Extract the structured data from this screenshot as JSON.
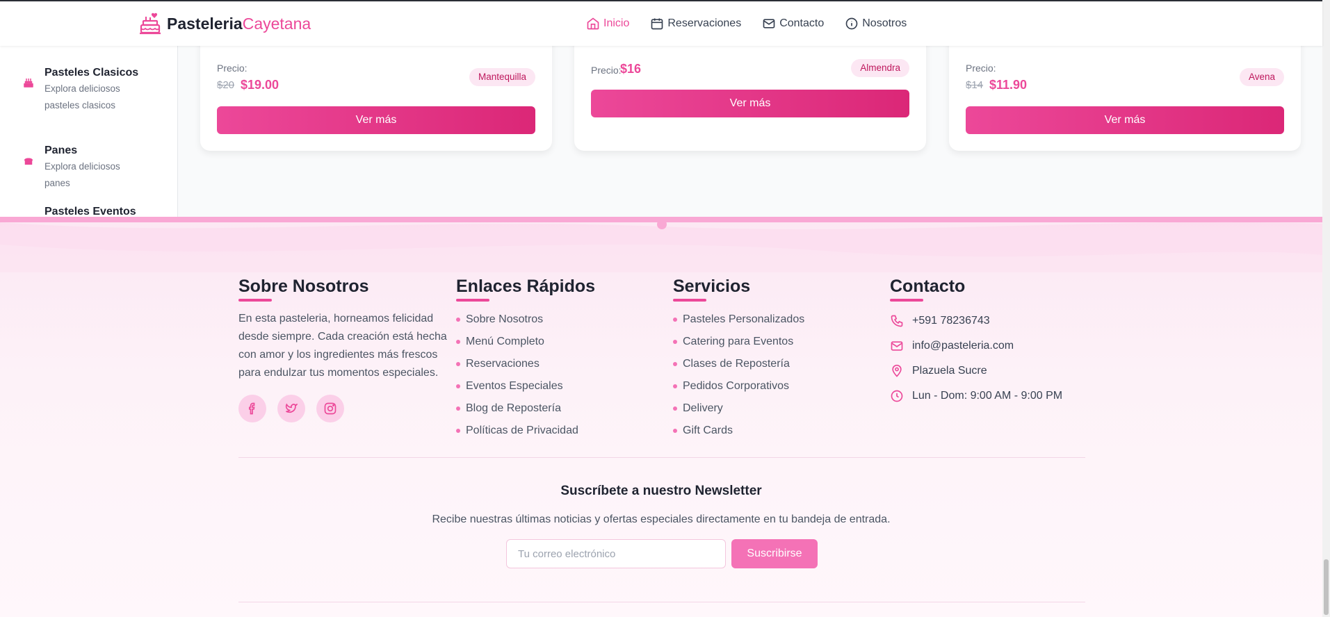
{
  "brand": {
    "name_bold": "Pasteleria",
    "name_light": "Cayetana",
    "logo_icon": "cake-icon"
  },
  "nav": [
    {
      "label": "Inicio",
      "icon": "home-icon",
      "active": true
    },
    {
      "label": "Reservaciones",
      "icon": "calendar-icon",
      "active": false
    },
    {
      "label": "Contacto",
      "icon": "mail-icon",
      "active": false
    },
    {
      "label": "Nosotros",
      "icon": "info-icon",
      "active": false
    }
  ],
  "sidebar": {
    "items": [
      {
        "title": "Pasteles Clasicos",
        "desc": "Explora deliciosos pasteles clasicos",
        "icon": "cake-icon"
      },
      {
        "title": "Panes",
        "desc": "Explora deliciosos panes",
        "icon": "bread-icon"
      },
      {
        "title": "Pasteles Eventos",
        "desc": "",
        "icon": ""
      }
    ]
  },
  "products": [
    {
      "price_label": "Precio:",
      "old_price": "$20",
      "price": "$19.00",
      "tag": "Mantequilla",
      "button": "Ver más"
    },
    {
      "price_label": "Precio:",
      "old_price": "",
      "price": "$16",
      "tag": "Almendra",
      "button": "Ver más"
    },
    {
      "price_label": "Precio:",
      "old_price": "$14",
      "price": "$11.90",
      "tag": "Avena",
      "button": "Ver más"
    }
  ],
  "footer": {
    "about": {
      "title": "Sobre Nosotros",
      "text": "En esta pasteleria, horneamos felicidad desde siempre. Cada creación está hecha con amor y los ingredientes más frescos para endulzar tus momentos especiales.",
      "socials": [
        "facebook-icon",
        "twitter-icon",
        "instagram-icon"
      ]
    },
    "links": {
      "title": "Enlaces Rápidos",
      "items": [
        "Sobre Nosotros",
        "Menú Completo",
        "Reservaciones",
        "Eventos Especiales",
        "Blog de Repostería",
        "Políticas de Privacidad"
      ]
    },
    "services": {
      "title": "Servicios",
      "items": [
        "Pasteles Personalizados",
        "Catering para Eventos",
        "Clases de Repostería",
        "Pedidos Corporativos",
        "Delivery",
        "Gift Cards"
      ]
    },
    "contact": {
      "title": "Contacto",
      "items": [
        {
          "icon": "phone-icon",
          "text": "+591 78236743"
        },
        {
          "icon": "mail-icon",
          "text": "info@pasteleria.com"
        },
        {
          "icon": "location-icon",
          "text": "Plazuela Sucre"
        },
        {
          "icon": "clock-icon",
          "text": "Lun - Dom: 9:00 AM - 9:00 PM"
        }
      ]
    },
    "newsletter": {
      "title": "Suscríbete a nuestro Newsletter",
      "desc": "Recibe nuestras últimas noticias y ofertas especiales directamente en tu bandeja de entrada.",
      "placeholder": "Tu correo electrónico",
      "button": "Suscribirse"
    }
  },
  "colors": {
    "accent": "#ec4899",
    "accent_dark": "#db2777",
    "tag_bg": "#fce7f3",
    "footer_bg": "#fdf2f8"
  }
}
